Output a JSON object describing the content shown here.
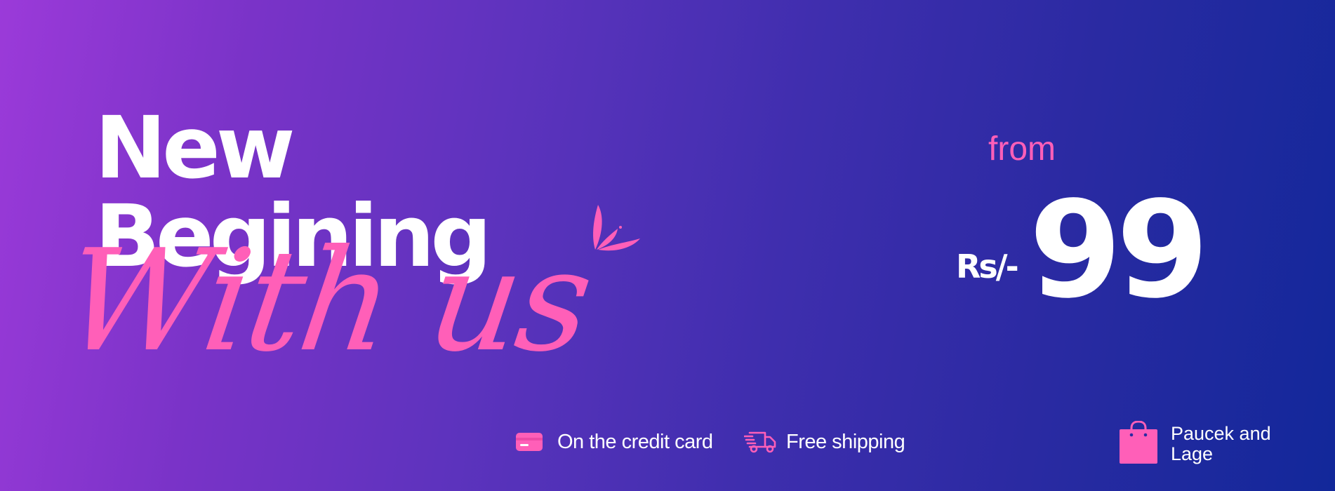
{
  "headline": {
    "line1": "New",
    "line2": "Begining"
  },
  "script_text": "With us",
  "price": {
    "prefix": "from",
    "currency": "Rs/-",
    "amount": "99"
  },
  "features": [
    {
      "icon": "credit-card-icon",
      "label": "On the credit card"
    },
    {
      "icon": "delivery-truck-icon",
      "label": "Free shipping"
    }
  ],
  "brand": {
    "icon": "shopping-bag-icon",
    "line1": "Paucek and",
    "line2": "Lage"
  },
  "colors": {
    "accent_pink": "#ff5fb8",
    "text_white": "#ffffff",
    "gradient_start": "#9b3ad9",
    "gradient_end": "#12289a"
  }
}
